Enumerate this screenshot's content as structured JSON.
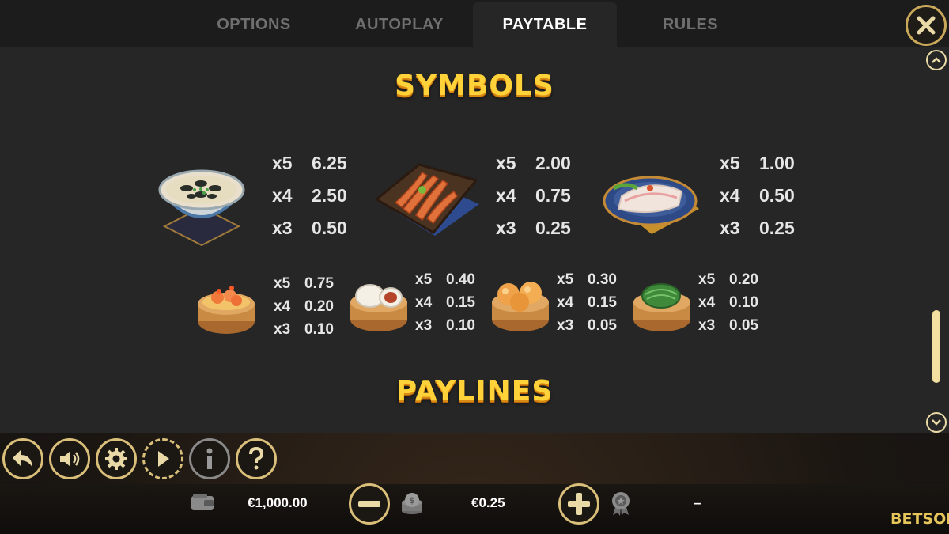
{
  "tabs": [
    {
      "label": "OPTIONS"
    },
    {
      "label": "AUTOPLAY"
    },
    {
      "label": "PAYTABLE"
    },
    {
      "label": "RULES"
    }
  ],
  "active_tab": "PAYTABLE",
  "sections": {
    "symbols_title": "SYMBOLS",
    "paylines_title": "PAYLINES"
  },
  "symbols_top": [
    {
      "icon": "congee-bowl-icon",
      "pays": [
        {
          "mult": "x5",
          "value": "6.25"
        },
        {
          "mult": "x4",
          "value": "2.50"
        },
        {
          "mult": "x3",
          "value": "0.50"
        }
      ]
    },
    {
      "icon": "chicken-feet-icon",
      "pays": [
        {
          "mult": "x5",
          "value": "2.00"
        },
        {
          "mult": "x4",
          "value": "0.75"
        },
        {
          "mult": "x3",
          "value": "0.25"
        }
      ]
    },
    {
      "icon": "rice-noodle-roll-icon",
      "pays": [
        {
          "mult": "x5",
          "value": "1.00"
        },
        {
          "mult": "x4",
          "value": "0.50"
        },
        {
          "mult": "x3",
          "value": "0.25"
        }
      ]
    }
  ],
  "symbols_bottom": [
    {
      "icon": "shrimp-dumpling-basket-icon",
      "pays": [
        {
          "mult": "x5",
          "value": "0.75"
        },
        {
          "mult": "x4",
          "value": "0.20"
        },
        {
          "mult": "x3",
          "value": "0.10"
        }
      ]
    },
    {
      "icon": "bbq-pork-bun-basket-icon",
      "pays": [
        {
          "mult": "x5",
          "value": "0.40"
        },
        {
          "mult": "x4",
          "value": "0.15"
        },
        {
          "mult": "x3",
          "value": "0.10"
        }
      ]
    },
    {
      "icon": "custard-bun-basket-icon",
      "pays": [
        {
          "mult": "x5",
          "value": "0.30"
        },
        {
          "mult": "x4",
          "value": "0.15"
        },
        {
          "mult": "x3",
          "value": "0.05"
        }
      ]
    },
    {
      "icon": "lotus-leaf-rice-basket-icon",
      "pays": [
        {
          "mult": "x5",
          "value": "0.20"
        },
        {
          "mult": "x4",
          "value": "0.10"
        },
        {
          "mult": "x3",
          "value": "0.05"
        }
      ]
    }
  ],
  "scroll": {
    "position": 0.72
  },
  "controls": {
    "buttons": [
      "back-arrow-icon",
      "sound-icon",
      "settings-gear-icon",
      "autoplay-icon",
      "info-icon",
      "help-icon"
    ]
  },
  "info": {
    "balance": "€1,000.00",
    "bet": "€0.25",
    "win": "–"
  },
  "brand": {
    "logo": "BETSOFT"
  },
  "colors": {
    "accent_gold": "#d9bf7a",
    "title_yellow": "#ffd23a",
    "panel": "#262626"
  }
}
